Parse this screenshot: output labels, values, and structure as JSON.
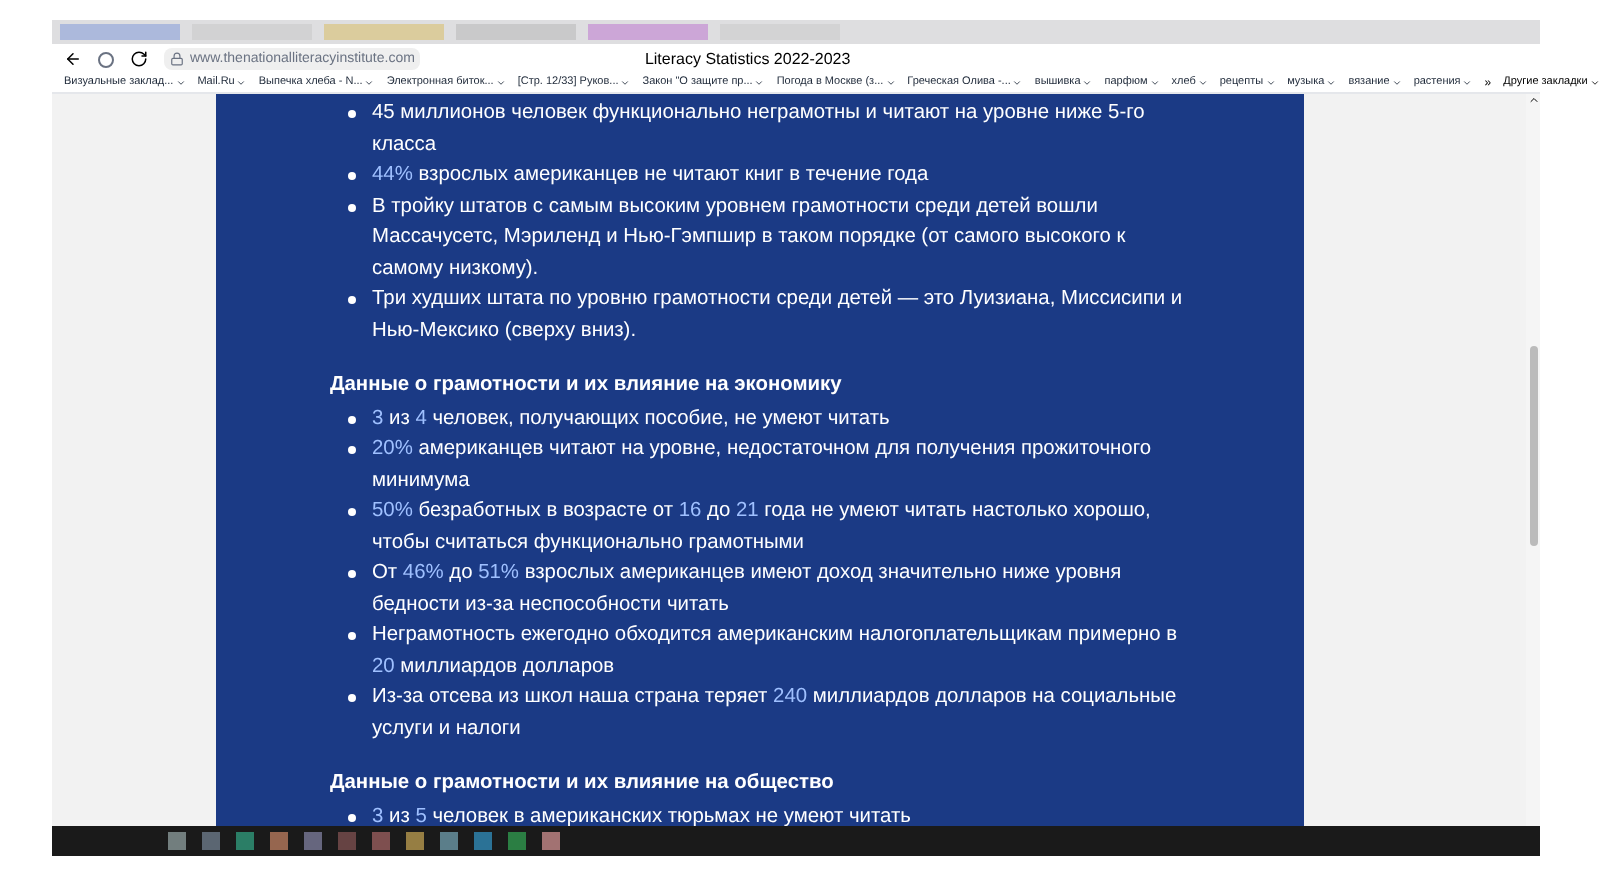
{
  "browser": {
    "url": "www.thenationalliteracyinstitute.com",
    "title": "Literacy Statistics 2022-2023",
    "bookmarks": [
      "Визуальные заклад...",
      "Mail.Ru",
      "Выпечка хлеба - N...",
      "Электронная биток...",
      "[Стр. 12/33] Руков...",
      "Закон \"О защите пр...",
      "Погода в Москве (з...",
      "Греческая Олива -...",
      "вышивка",
      "парфюм",
      "хлеб",
      "рецепты",
      "музыка",
      "вязание",
      "растения"
    ],
    "more": "»",
    "other_bookmarks": "Другие закладки"
  },
  "sections": [
    {
      "items": [
        [
          {
            "text": "45 миллионов человек функционально неграмотны и читают на уровне ниже 5-го класса",
            "highlight": false
          }
        ],
        [
          {
            "text": "44%",
            "highlight": true
          },
          {
            "text": " взрослых американцев не читают книг в течение года",
            "highlight": false
          }
        ],
        [
          {
            "text": "В тройку штатов с самым высоким уровнем грамотности среди детей вошли Массачусетс, Мэриленд и Нью-Гэмпшир в таком порядке (от самого высокого к самому низкому).",
            "highlight": false
          }
        ],
        [
          {
            "text": "Три худших штата по уровню грамотности среди детей — это Луизиана, Миссисипи и Нью-Мексико (сверху вниз).",
            "highlight": false
          }
        ]
      ]
    },
    {
      "heading": "Данные о грамотности и их влияние на экономику",
      "items": [
        [
          {
            "text": "3",
            "highlight": true
          },
          {
            "text": " из ",
            "highlight": false
          },
          {
            "text": "4",
            "highlight": true
          },
          {
            "text": " человек, получающих пособие, не умеют читать",
            "highlight": false
          }
        ],
        [
          {
            "text": "20%",
            "highlight": true
          },
          {
            "text": " американцев читают на уровне, недостаточном для получения прожиточного минимума",
            "highlight": false
          }
        ],
        [
          {
            "text": "50%",
            "highlight": true
          },
          {
            "text": " безработных в возрасте от ",
            "highlight": false
          },
          {
            "text": "16",
            "highlight": true
          },
          {
            "text": " до ",
            "highlight": false
          },
          {
            "text": "21",
            "highlight": true
          },
          {
            "text": " года не умеют читать настолько хорошо, чтобы считаться функционально грамотными",
            "highlight": false
          }
        ],
        [
          {
            "text": "От ",
            "highlight": false
          },
          {
            "text": "46%",
            "highlight": true
          },
          {
            "text": " до ",
            "highlight": false
          },
          {
            "text": "51%",
            "highlight": true
          },
          {
            "text": " взрослых американцев имеют доход значительно ниже уровня бедности из-за неспособности читать",
            "highlight": false
          }
        ],
        [
          {
            "text": "Неграмотность ежегодно обходится американским налогоплательщикам примерно в ",
            "highlight": false
          },
          {
            "text": "20",
            "highlight": true
          },
          {
            "text": " миллиардов долларов",
            "highlight": false
          }
        ],
        [
          {
            "text": "Из-за отсева из школ наша страна теряет ",
            "highlight": false
          },
          {
            "text": "240",
            "highlight": true
          },
          {
            "text": " миллиардов долларов на социальные услуги и налоги",
            "highlight": false
          }
        ]
      ]
    },
    {
      "heading": "Данные о грамотности и их влияние на общество",
      "items": [
        [
          {
            "text": "3",
            "highlight": true
          },
          {
            "text": " из ",
            "highlight": false
          },
          {
            "text": "5",
            "highlight": true
          },
          {
            "text": " человек в американских тюрьмах не умеют читать",
            "highlight": false
          }
        ]
      ]
    }
  ]
}
